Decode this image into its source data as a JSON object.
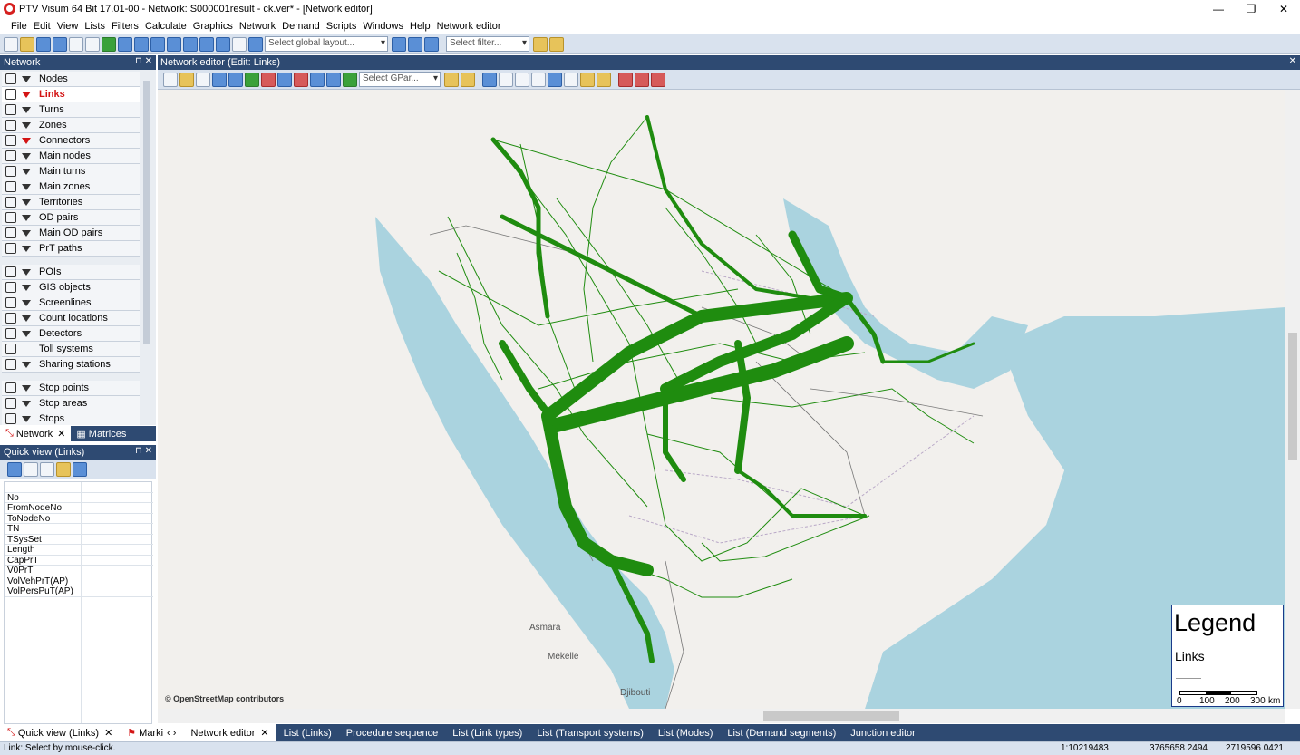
{
  "window": {
    "title": "PTV Visum 64 Bit 17.01-00 - Network: S000001result - ck.ver* - [Network editor]"
  },
  "menu": [
    "File",
    "Edit",
    "View",
    "Lists",
    "Filters",
    "Calculate",
    "Graphics",
    "Network",
    "Demand",
    "Scripts",
    "Windows",
    "Help",
    "Network editor"
  ],
  "toolbar": {
    "layout_placeholder": "Select global layout...",
    "filter_placeholder": "Select filter..."
  },
  "network_panel": {
    "title": "Network",
    "items": [
      {
        "label": "Nodes",
        "icon": "node-icon",
        "filter": "normal"
      },
      {
        "label": "Links",
        "icon": "link-icon",
        "filter": "red"
      },
      {
        "label": "Turns",
        "icon": "turn-icon",
        "filter": "normal"
      },
      {
        "label": "Zones",
        "icon": "zone-icon",
        "filter": "normal"
      },
      {
        "label": "Connectors",
        "icon": "connector-icon",
        "filter": "red"
      },
      {
        "label": "Main nodes",
        "icon": "main-node-icon",
        "filter": "normal"
      },
      {
        "label": "Main turns",
        "icon": "main-turn-icon",
        "filter": "normal"
      },
      {
        "label": "Main zones",
        "icon": "main-zone-icon",
        "filter": "normal"
      },
      {
        "label": "Territories",
        "icon": "territory-icon",
        "filter": "normal"
      },
      {
        "label": "OD pairs",
        "icon": "od-pair-icon",
        "filter": "normal"
      },
      {
        "label": "Main OD pairs",
        "icon": "main-od-pair-icon",
        "filter": "normal"
      },
      {
        "label": "PrT paths",
        "icon": "prt-path-icon",
        "filter": "normal"
      },
      {
        "label": "POIs",
        "icon": "poi-icon",
        "filter": "normal"
      },
      {
        "label": "GIS objects",
        "icon": "gis-icon",
        "filter": "normal"
      },
      {
        "label": "Screenlines",
        "icon": "screenline-icon",
        "filter": "normal"
      },
      {
        "label": "Count locations",
        "icon": "count-location-icon",
        "filter": "normal"
      },
      {
        "label": "Detectors",
        "icon": "detector-icon",
        "filter": "normal"
      },
      {
        "label": "Toll systems",
        "icon": "toll-icon",
        "filter": "none"
      },
      {
        "label": "Sharing stations",
        "icon": "sharing-station-icon",
        "filter": "normal"
      },
      {
        "label": "Stop points",
        "icon": "stop-point-icon",
        "filter": "normal"
      },
      {
        "label": "Stop areas",
        "icon": "stop-area-icon",
        "filter": "normal"
      },
      {
        "label": "Stops",
        "icon": "stop-icon",
        "filter": "normal"
      }
    ],
    "active_item": "Links"
  },
  "panel_tabs": [
    "Network",
    "Matrices"
  ],
  "quick_view": {
    "title": "Quick view (Links)",
    "rows": [
      "No",
      "FromNodeNo",
      "ToNodeNo",
      "TN",
      "TSysSet",
      "Length",
      "CapPrT",
      "V0PrT",
      "VolVehPrT(AP)",
      "VolPersPuT(AP)"
    ]
  },
  "network_editor": {
    "title": "Network editor (Edit: Links)",
    "gpar_placeholder": "Select GPar...",
    "map_attribution": "© OpenStreetMap contributors",
    "legend": {
      "title": "Legend",
      "subtitle": "Links",
      "scale_labels": [
        "0",
        "100",
        "200",
        "300",
        "km"
      ]
    },
    "map_labels": [
      "Asmara",
      "Djibouti",
      "Mekelle"
    ]
  },
  "bottom_tabs": [
    "Quick view (Links)",
    "Marki",
    "Network editor",
    "List (Links)",
    "Procedure sequence",
    "List (Link types)",
    "List (Transport systems)",
    "List (Modes)",
    "List (Demand segments)",
    "Junction editor"
  ],
  "status": {
    "left": "Link: Select by mouse-click.",
    "scale": "1:10219483",
    "x": "3765658.2494",
    "y": "2719596.0421"
  },
  "colors": {
    "network_green": "#1f8c0f",
    "panel_header": "#2e4a72",
    "active_red": "#d31414"
  }
}
